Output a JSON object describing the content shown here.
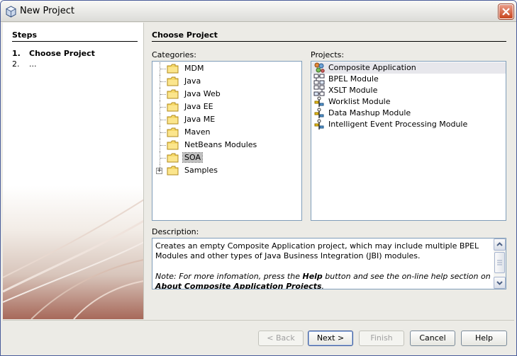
{
  "window": {
    "title": "New Project"
  },
  "steps": {
    "heading": "Steps",
    "items": [
      {
        "num": "1.",
        "label": "Choose Project"
      },
      {
        "num": "2.",
        "label": "..."
      }
    ]
  },
  "main": {
    "heading": "Choose Project",
    "categories_label": "Categories:",
    "projects_label": "Projects:",
    "description_label": "Description:"
  },
  "categories": [
    {
      "label": "MDM"
    },
    {
      "label": "Java"
    },
    {
      "label": "Java Web"
    },
    {
      "label": "Java EE"
    },
    {
      "label": "Java ME"
    },
    {
      "label": "Maven"
    },
    {
      "label": "NetBeans Modules"
    },
    {
      "label": "SOA",
      "selected": true
    },
    {
      "label": "Samples",
      "expandable": true
    }
  ],
  "projects": [
    {
      "label": "Composite Application",
      "icon": "composite-app-icon",
      "selected": true
    },
    {
      "label": "BPEL Module",
      "icon": "bpel-module-icon"
    },
    {
      "label": "XSLT Module",
      "icon": "xslt-module-icon"
    },
    {
      "label": "Worklist Module",
      "icon": "worklist-module-icon"
    },
    {
      "label": "Data Mashup Module",
      "icon": "data-mashup-module-icon"
    },
    {
      "label": "Intelligent Event Processing Module",
      "icon": "iep-module-icon"
    }
  ],
  "description": {
    "text": "Creates an empty Composite Application project, which may include multiple BPEL Modules and other types of Java Business Integration (JBI) modules.",
    "note_prefix": "Note: For more infomation, press the ",
    "note_help": "Help",
    "note_middle": " button and see the on-line help section on ",
    "note_link": "About Composite Application Projects",
    "note_end": "."
  },
  "buttons": {
    "back": "< Back",
    "next": "Next >",
    "finish": "Finish",
    "cancel": "Cancel",
    "help": "Help"
  }
}
